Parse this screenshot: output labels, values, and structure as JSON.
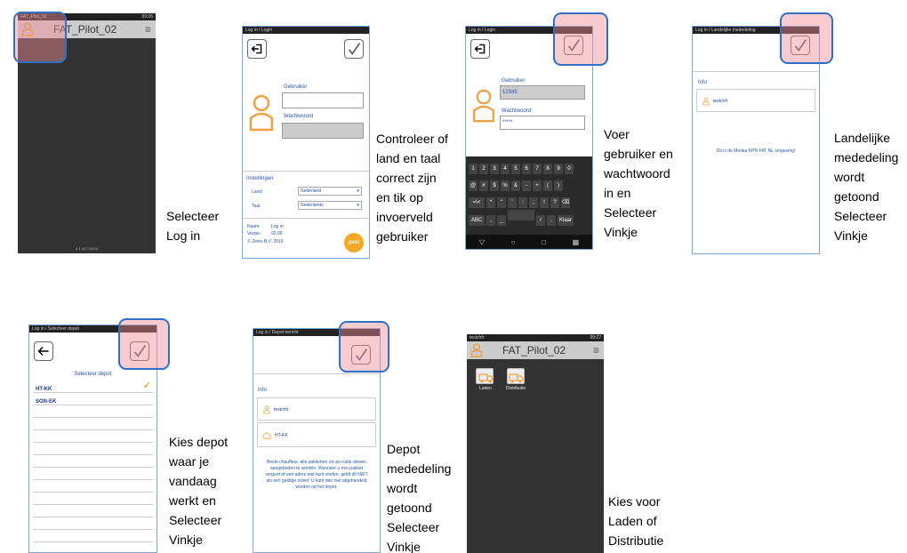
{
  "screens": {
    "s1": {
      "status_left": "FAT_Pilot_02",
      "status_right": "09:26",
      "title": "FAT_Pilot_02",
      "version": "4.1.0(170309)"
    },
    "s2": {
      "status_left": "Log in / Login",
      "gebruiker_label": "Gebruiker",
      "wachtwoord_label": "Wachtwoord",
      "instellingen_label": "Instellingen",
      "land_label": "Land:",
      "land_value": "Nederland",
      "taal_label": "Taal:",
      "taal_value": "Nederlands",
      "naam_label": "Naam:",
      "naam_value": "Log in",
      "versie_label": "Versie:",
      "versie_value": "02.09",
      "copyright": "© Zetes B.V. 2016",
      "logo": "post"
    },
    "s3": {
      "status_left": "Log in / Login",
      "gebruiker_label": "Gebruiker",
      "gebruiker_value": "12345",
      "wachtwoord_label": "Wachtwoord",
      "wachtwoord_value": "*****",
      "kb_row1": [
        "1",
        "2",
        "3",
        "4",
        "5",
        "6",
        "7",
        "8",
        "9",
        "0"
      ],
      "kb_row2": [
        "@",
        "#",
        "$",
        "%",
        "&",
        "-",
        "+",
        "(",
        ")"
      ],
      "kb_row3": [
        "=\\<",
        "*",
        "\"",
        "'",
        ":",
        ";",
        "!",
        "?",
        "⌫"
      ],
      "kb_row4": [
        "ABC",
        ",",
        "_",
        "",
        "/",
        ".",
        "Klaar"
      ]
    },
    "s4": {
      "status_left": "Log in / Landelijke mededeling",
      "info_label": "Info",
      "user": "testchfr",
      "message": "Dit is de Medea KPN FAT NL omgeving!"
    },
    "s5": {
      "status_left": "Log in / Selecteer depot",
      "header": "Selecteer depot",
      "depots": [
        "HT-KK",
        "SON-EK"
      ]
    },
    "s6": {
      "status_left": "Log in / Depot bericht",
      "info_label": "Info",
      "user": "testchfr",
      "depot": "HT-KK",
      "message": "Beste chauffeur, alle pakketten uit uw route dienen aangeboden te worden. Wanneer u een pakket vergeet of een adres niet kunt vinden, geldt dit NIET als een geldige reden! U kunt dan niet afgehandeld worden op het depot."
    },
    "s7": {
      "status_left": "testchfr",
      "status_right": "09:27",
      "title": "FAT_Pilot_02",
      "tile1": "Laden",
      "tile2": "Distributie"
    }
  },
  "captions": {
    "c1": [
      "Selecteer",
      "Log in"
    ],
    "c2": [
      "Controleer of",
      "land en taal",
      "correct zijn",
      "en tik op",
      "invoerveld",
      "gebruiker"
    ],
    "c3": [
      "Voer",
      "gebruiker en",
      "wachtwoord",
      "in en",
      "Selecteer",
      "Vinkje"
    ],
    "c4": [
      "Landelijke",
      "mededeling",
      "wordt",
      "getoond",
      "Selecteer",
      "Vinkje"
    ],
    "c5": [
      "Kies depot",
      "waar je",
      "vandaag",
      "werkt en",
      "Selecteer",
      "Vinkje"
    ],
    "c6": [
      "Depot",
      "mededeling",
      "wordt",
      "getoond",
      "Selecteer",
      "Vinkje"
    ],
    "c7": [
      "Kies voor",
      "Laden of",
      "Distributie"
    ]
  },
  "colors": {
    "highlight_border": "#2f6fc4",
    "highlight_fill": "#f08c96",
    "accent_orange": "#f0a040",
    "text_blue": "#2a56a6"
  }
}
